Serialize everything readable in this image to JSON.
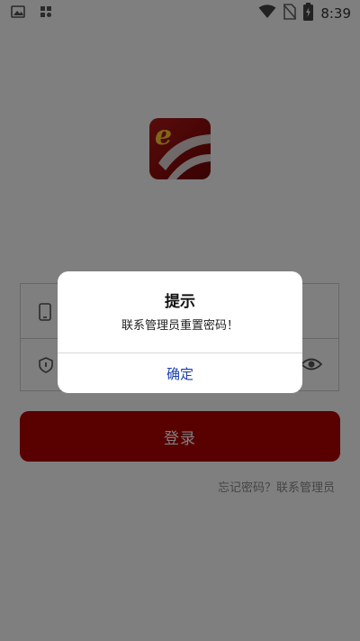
{
  "status_bar": {
    "time": "8:39",
    "left_icons": [
      "image-icon",
      "grid-app-icon"
    ],
    "right_icons": [
      "wifi-icon",
      "no-sim-icon",
      "battery-charging-icon"
    ]
  },
  "app": {
    "logo_letter": "e",
    "login_button_label": "登录",
    "forgot_password_text": "忘记密码？联系管理员",
    "form": {
      "account_icon": "phone-icon",
      "password_icon": "shield-lock-icon",
      "visibility_icon": "eye-icon"
    }
  },
  "dialog": {
    "title": "提示",
    "message": "联系管理员重置密码！",
    "confirm_label": "确定"
  },
  "colors": {
    "accent_red": "#b30000",
    "dialog_link_blue": "#1a3fae",
    "overlay": "rgba(0,0,0,0.5)"
  }
}
